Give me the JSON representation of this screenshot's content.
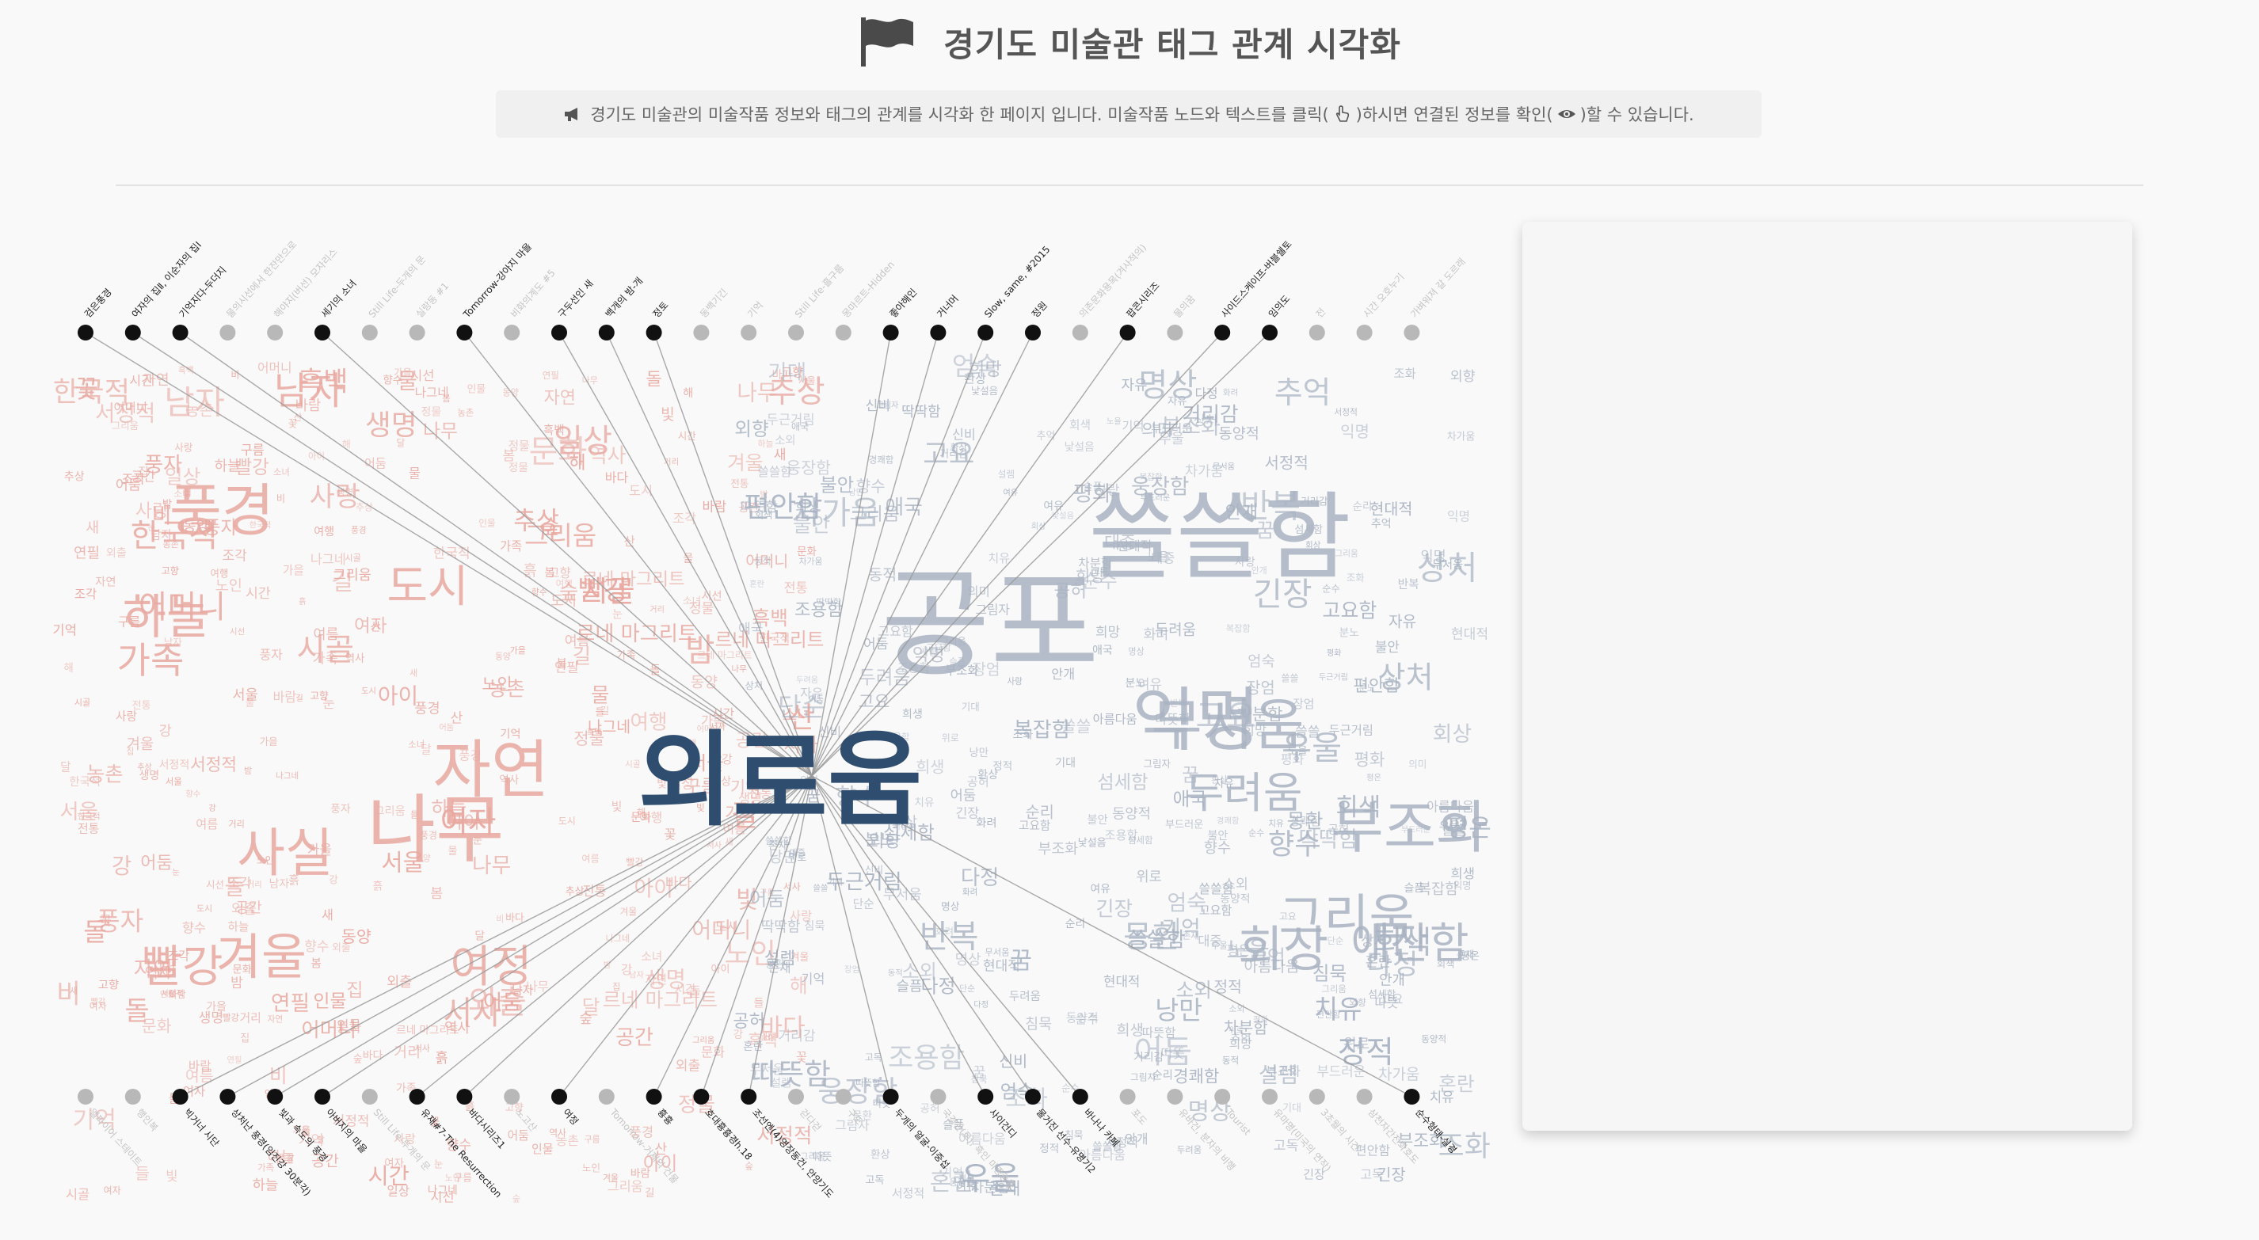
{
  "header": {
    "title": "경기도 미술관 태그 관계 시각화",
    "flag_icon": "flag-icon"
  },
  "info": {
    "part1": "경기도 미술관의 미술작품 정보와 태그의 관계를 시각화 한 페이지 입니다. 미술작품 노드와 텍스트를 클릭(",
    "part2": ")하시면 연결된 정보를 확인(",
    "part3": ")할 수 있습니다.",
    "megaphone_icon": "megaphone-icon",
    "hand_icon": "pointer-hand-icon",
    "eye_icon": "eye-icon"
  },
  "colors": {
    "red_tags": "#e8a8a0",
    "blue_tags": "#a9b3c2",
    "selected_tag": "#2f4d6e",
    "active_node": "#111111",
    "inactive_node": "#b8b8b8",
    "link": "#9a9a9a"
  },
  "selected_tag": "외로움",
  "top_artworks": [
    {
      "label": "검은풍경",
      "active": true
    },
    {
      "label": "여자의 집Ⅱ, 이순자의 집Ⅰ",
      "active": true
    },
    {
      "label": "기억지다-두더지",
      "active": true
    },
    {
      "label": "물의시선에서 한잔만으로",
      "active": false
    },
    {
      "label": "해야지(버선) 모자리스",
      "active": false
    },
    {
      "label": "세기의 소녀",
      "active": true
    },
    {
      "label": "Still Life-두개의 문",
      "active": false
    },
    {
      "label": "실랑동 #1",
      "active": false
    },
    {
      "label": "Tomorrow-강아지 마을",
      "active": true
    },
    {
      "label": "비화의계도 #5",
      "active": false
    },
    {
      "label": "구두선인 새",
      "active": true
    },
    {
      "label": "백개의 밤-개",
      "active": true
    },
    {
      "label": "정토",
      "active": true
    },
    {
      "label": "동백기긴",
      "active": false
    },
    {
      "label": "기억",
      "active": false
    },
    {
      "label": "Still Life-흘구름",
      "active": false
    },
    {
      "label": "몽마르트-Hidden",
      "active": false
    },
    {
      "label": "좋아해인",
      "active": true
    },
    {
      "label": "거너머",
      "active": true
    },
    {
      "label": "Slow, same, #2015",
      "active": true
    },
    {
      "label": "정원",
      "active": true
    },
    {
      "label": "의존문화용목(겨사적의)",
      "active": false
    },
    {
      "label": "팝콘시리즈",
      "active": true
    },
    {
      "label": "물의꿈",
      "active": false
    },
    {
      "label": "사이드스케이프-버블쉘토",
      "active": true
    },
    {
      "label": "임의도",
      "active": true
    },
    {
      "label": "전",
      "active": false
    },
    {
      "label": "시간 오호누기",
      "active": false
    },
    {
      "label": "가벼워져 갈 도르래",
      "active": false
    }
  ],
  "bottom_artworks": [
    {
      "label": "엘파이어 스테이트",
      "active": false
    },
    {
      "label": "행인복",
      "active": false
    },
    {
      "label": "빅거너 시단",
      "active": true
    },
    {
      "label": "상처난 풍경(임진강 30분각)",
      "active": true
    },
    {
      "label": "빛과 속도의 풍경",
      "active": true
    },
    {
      "label": "아버지의 마을",
      "active": true
    },
    {
      "label": "Still Life-두개의 문",
      "active": false
    },
    {
      "label": "유재#7-The Resurrection",
      "active": true
    },
    {
      "label": "바다시리즈1",
      "active": true
    },
    {
      "label": "노고산",
      "active": false
    },
    {
      "label": "여정",
      "active": true
    },
    {
      "label": "Tomorrow-거제의 건물",
      "active": false
    },
    {
      "label": "흉흉",
      "active": true
    },
    {
      "label": "호대흉흉경h.18",
      "active": true
    },
    {
      "label": "조선엔(4)영장동건, 안양기도",
      "active": true
    },
    {
      "label": "걷다걷",
      "active": false
    },
    {
      "label": "구도",
      "active": false
    },
    {
      "label": "두개의 얼굴-이중섭",
      "active": true
    },
    {
      "label": "국경관(로), 흑인 마중중증",
      "active": false
    },
    {
      "label": "사이건디",
      "active": true
    },
    {
      "label": "물거진 선수-유명기2",
      "active": true
    },
    {
      "label": "바나나 카페",
      "active": true
    },
    {
      "label": "포도",
      "active": false
    },
    {
      "label": "유바건, 분자의 비행",
      "active": false
    },
    {
      "label": "Tourist",
      "active": false
    },
    {
      "label": "유마명(미국의 연작)",
      "active": false
    },
    {
      "label": "3초월의 시간",
      "active": false
    },
    {
      "label": "삼천자간전화호도",
      "active": false
    },
    {
      "label": "순수형태-실경",
      "active": true
    }
  ],
  "red_cloud_tags": [
    "풍경",
    "나무",
    "자연",
    "하늘",
    "남자",
    "여자",
    "도시",
    "거리",
    "가족",
    "빨강",
    "겨울",
    "어머니",
    "한국적",
    "여행",
    "바다",
    "서정적",
    "인물",
    "동양",
    "해",
    "서사",
    "문화",
    "조각",
    "연필",
    "서울",
    "정물",
    "나그네",
    "흑백",
    "추상",
    "외출",
    "향수",
    "그리움",
    "기억",
    "산",
    "꽃",
    "시간",
    "길",
    "생명",
    "집",
    "아이",
    "사랑",
    "강",
    "봄",
    "밤",
    "숲",
    "새",
    "물",
    "고향",
    "전통",
    "역사",
    "풍자",
    "들",
    "일상",
    "시선",
    "여름",
    "소녀",
    "노인",
    "눈",
    "빛",
    "어둠",
    "공간",
    "르네 마그리트",
    "시골",
    "농촌",
    "가을",
    "비",
    "달",
    "구름",
    "바람",
    "돌",
    "흙"
  ],
  "blue_cloud_tags": [
    "쓸쓸함",
    "익명",
    "무서움",
    "쓸쓸",
    "부드러운",
    "다정",
    "평화",
    "고요",
    "기억",
    "두려움",
    "그리움",
    "부조화",
    "안개",
    "불안",
    "회색",
    "어둠",
    "동양적",
    "슬픔",
    "침묵",
    "환상",
    "고독",
    "명상",
    "꿈",
    "고요함",
    "따뜻함",
    "차가움",
    "우울",
    "희망",
    "아름다움",
    "자유",
    "순리",
    "애국",
    "신비",
    "서정적",
    "조용함",
    "평온",
    "섬세함",
    "화려",
    "소외",
    "긴장",
    "거리감",
    "공허",
    "그림자",
    "현대적",
    "사랑",
    "희생",
    "위로",
    "여유",
    "조화",
    "혼란",
    "기대",
    "분노",
    "순수",
    "존재",
    "상처",
    "치유",
    "회상",
    "향수",
    "추억",
    "반복",
    "외향",
    "의미",
    "대중",
    "복잡함",
    "웅장함",
    "편안함",
    "따뜻",
    "낯설음",
    "설렘",
    "두근거림",
    "엄숙",
    "장엄",
    "경쾌함",
    "단순",
    "딱딱함",
    "차분함",
    "동적",
    "정적",
    "낭만",
    "몽환",
    "노을"
  ],
  "big_tags": [
    {
      "label": "쓸쓸함",
      "color": "blue"
    },
    {
      "label": "공포",
      "color": "blue"
    },
    {
      "label": "익명",
      "color": "blue"
    },
    {
      "label": "무서움",
      "color": "blue"
    },
    {
      "label": "부조화",
      "color": "blue"
    },
    {
      "label": "그리움",
      "color": "blue"
    },
    {
      "label": "애잔함",
      "color": "blue"
    },
    {
      "label": "회상",
      "color": "blue"
    },
    {
      "label": "두려움",
      "color": "blue"
    },
    {
      "label": "풍경",
      "color": "red"
    },
    {
      "label": "나무",
      "color": "red"
    },
    {
      "label": "자연",
      "color": "red"
    },
    {
      "label": "하늘",
      "color": "red"
    },
    {
      "label": "사실",
      "color": "red"
    },
    {
      "label": "여정",
      "color": "red"
    },
    {
      "label": "겨울",
      "color": "red"
    },
    {
      "label": "빨강",
      "color": "red"
    },
    {
      "label": "남자",
      "color": "red"
    },
    {
      "label": "도시",
      "color": "red"
    },
    {
      "label": "가족",
      "color": "red"
    },
    {
      "label": "어머니",
      "color": "red"
    },
    {
      "label": "한국적",
      "color": "red"
    }
  ]
}
